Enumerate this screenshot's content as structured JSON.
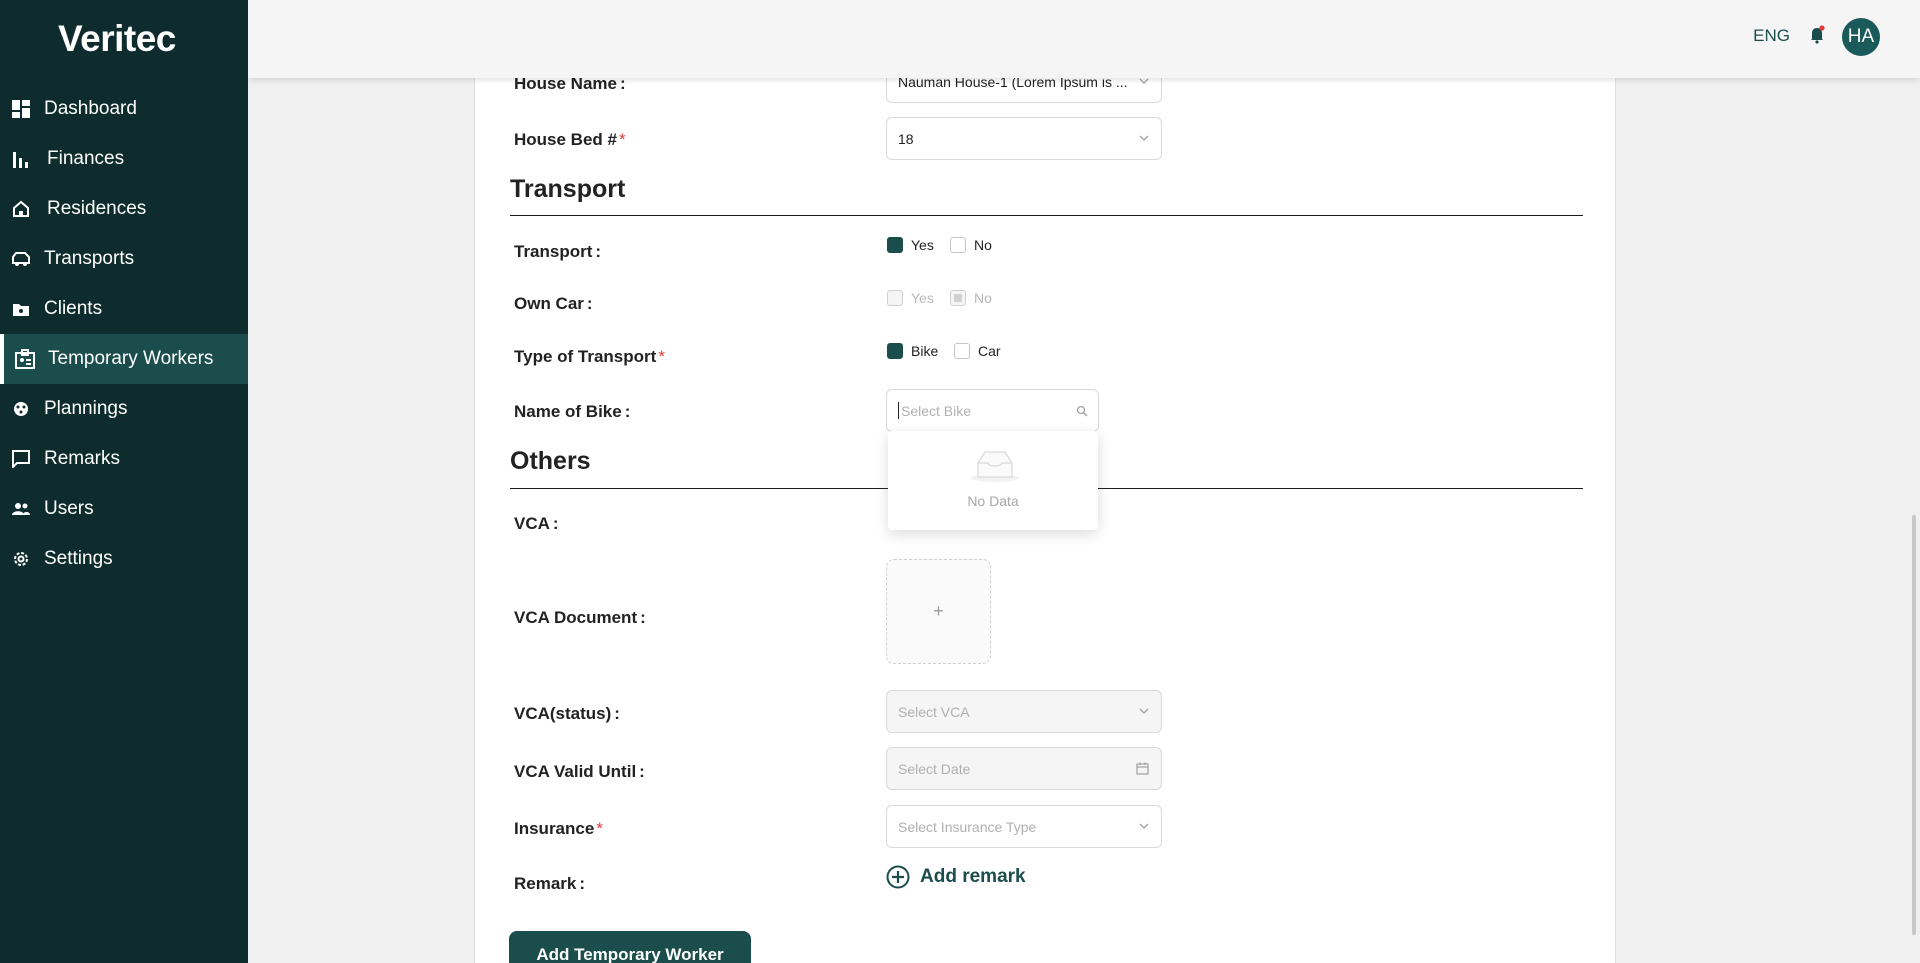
{
  "app": {
    "logo": "Veritec"
  },
  "sidebar": {
    "items": [
      {
        "label": "Dashboard",
        "icon": "dashboard-icon"
      },
      {
        "label": "Finances",
        "icon": "bar-chart-icon"
      },
      {
        "label": "Residences",
        "icon": "home-icon"
      },
      {
        "label": "Transports",
        "icon": "car-icon"
      },
      {
        "label": "Clients",
        "icon": "folder-icon"
      },
      {
        "label": "Temporary Workers",
        "icon": "id-card-icon",
        "active": true
      },
      {
        "label": "Plannings",
        "icon": "planning-icon"
      },
      {
        "label": "Remarks",
        "icon": "comment-icon"
      },
      {
        "label": "Users",
        "icon": "users-icon"
      },
      {
        "label": "Settings",
        "icon": "gear-icon"
      }
    ]
  },
  "header": {
    "language": "ENG",
    "avatar_initials": "HA"
  },
  "form": {
    "house_name": {
      "label": "House Name",
      "value": "Nauman House-1 (Lorem Ipsum is ..."
    },
    "house_bed": {
      "label": "House Bed #",
      "value": "18"
    },
    "transport_section": {
      "title": "Transport"
    },
    "transport": {
      "label": "Transport",
      "yes": "Yes",
      "no": "No"
    },
    "own_car": {
      "label": "Own Car",
      "yes": "Yes",
      "no": "No"
    },
    "type_of_transport": {
      "label": "Type of Transport",
      "bike": "Bike",
      "car": "Car"
    },
    "name_of_bike": {
      "label": "Name of Bike",
      "placeholder": "Select Bike",
      "empty_text": "No Data"
    },
    "others_section": {
      "title": "Others"
    },
    "vca": {
      "label": "VCA"
    },
    "vca_document": {
      "label": "VCA Document",
      "upload": "+"
    },
    "vca_status": {
      "label": "VCA(status)",
      "placeholder": "Select VCA"
    },
    "vca_valid_until": {
      "label": "VCA Valid Until",
      "placeholder": "Select Date"
    },
    "insurance": {
      "label": "Insurance",
      "placeholder": "Select Insurance Type"
    },
    "remark": {
      "label": "Remark",
      "add_label": "Add remark"
    },
    "submit_label": "Add Temporary Worker"
  },
  "colors": {
    "sidebar_bg": "#0e2b2d",
    "accent": "#1b4d4d",
    "required": "#e23b3b"
  }
}
